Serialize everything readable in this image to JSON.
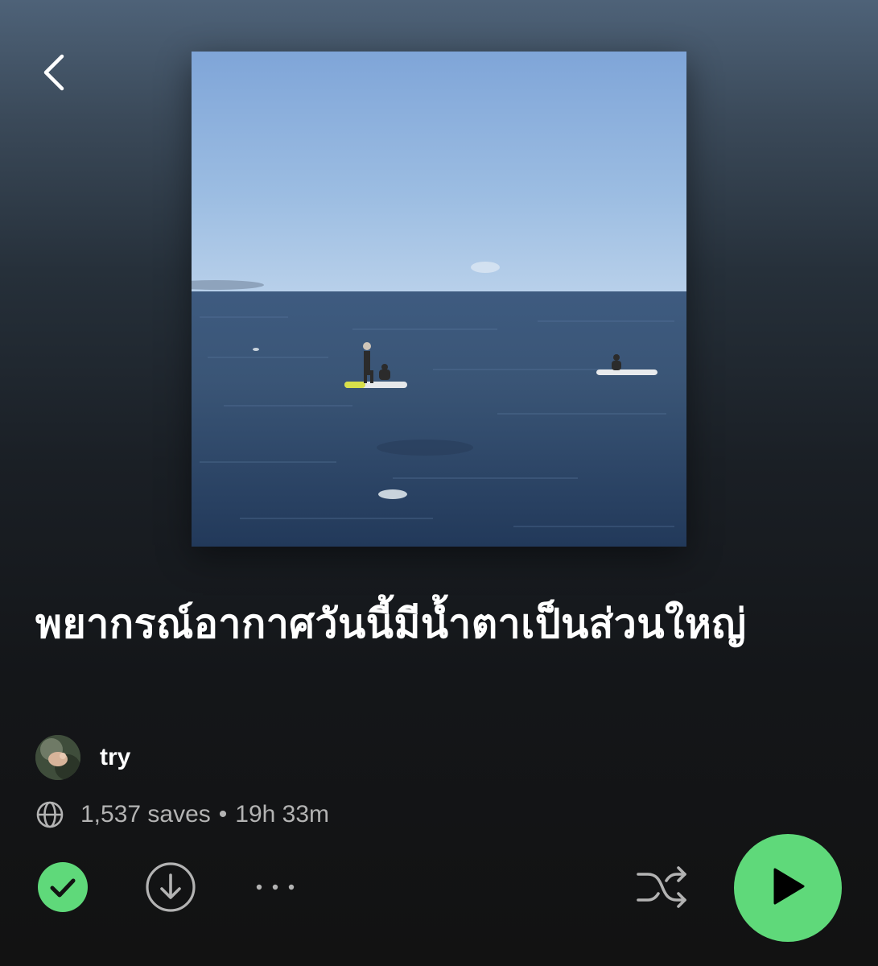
{
  "header": {
    "back_icon": "chevron-left-icon"
  },
  "cover": {
    "image_description": "sea-with-paddleboarders"
  },
  "playlist": {
    "title": "พยากรณ์อากาศวันนี้มีน้ำตาเป็นส่วนใหญ่",
    "owner_name": "try",
    "saves": "1,537 saves",
    "separator": "•",
    "duration": "19h 33m"
  },
  "actions": {
    "saved_icon": "check-circle-icon",
    "download_icon": "download-icon",
    "more_label": "• • •",
    "shuffle_icon": "shuffle-icon",
    "play_icon": "play-icon"
  },
  "colors": {
    "accent_green": "#5fd97a",
    "text_secondary": "#b3b3b3"
  }
}
